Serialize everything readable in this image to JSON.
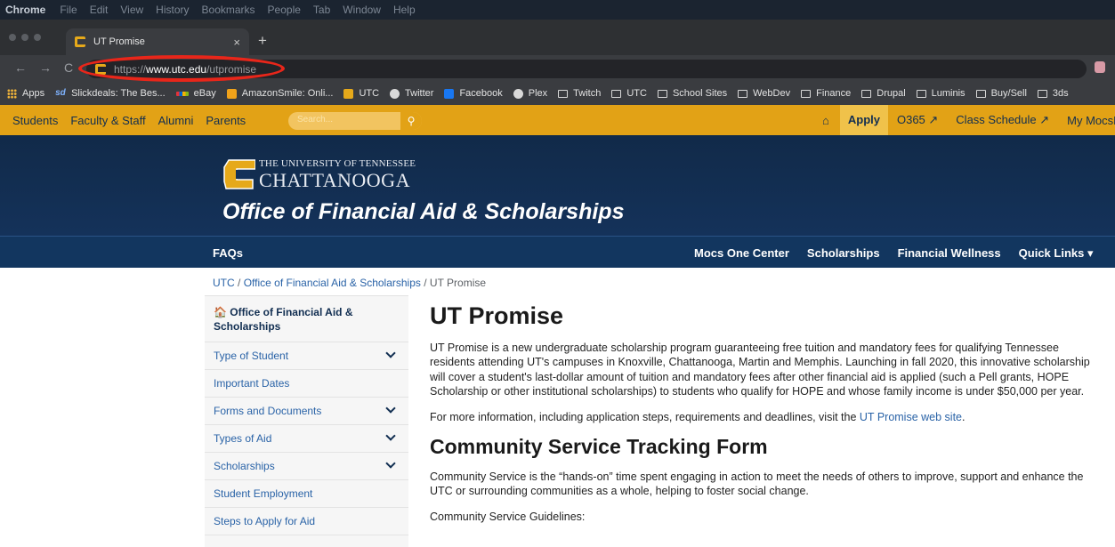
{
  "os_menubar": [
    "Chrome",
    "File",
    "Edit",
    "View",
    "History",
    "Bookmarks",
    "People",
    "Tab",
    "Window",
    "Help"
  ],
  "browser": {
    "tab_title": "UT Promise",
    "tab_close": "×",
    "new_tab": "+",
    "url_prefix": "https://",
    "url_host": "www.utc.edu",
    "url_path": "/utpromise",
    "bookmarks": [
      {
        "label": "Apps",
        "icon": "apps-icon"
      },
      {
        "label": "Slickdeals: The Bes...",
        "icon": "sd-icon"
      },
      {
        "label": "eBay",
        "icon": "ebay-icon"
      },
      {
        "label": "AmazonSmile: Onli...",
        "icon": "amazon-icon"
      },
      {
        "label": "UTC",
        "icon": "utc-icon"
      },
      {
        "label": "Twitter",
        "icon": "twitter-icon"
      },
      {
        "label": "Facebook",
        "icon": "facebook-icon"
      },
      {
        "label": "Plex",
        "icon": "plex-icon"
      },
      {
        "label": "Twitch",
        "icon": "folder-icon"
      },
      {
        "label": "UTC",
        "icon": "folder-icon"
      },
      {
        "label": "School Sites",
        "icon": "folder-icon"
      },
      {
        "label": "WebDev",
        "icon": "folder-icon"
      },
      {
        "label": "Finance",
        "icon": "folder-icon"
      },
      {
        "label": "Drupal",
        "icon": "folder-icon"
      },
      {
        "label": "Luminis",
        "icon": "folder-icon"
      },
      {
        "label": "Buy/Sell",
        "icon": "folder-icon"
      },
      {
        "label": "3ds",
        "icon": "folder-icon"
      }
    ]
  },
  "utility_bar": {
    "left_links": [
      "Students",
      "Faculty & Staff",
      "Alumni",
      "Parents"
    ],
    "search_placeholder": "Search...",
    "apply": "Apply",
    "o365": "O365 ↗",
    "class_schedule": "Class Schedule ↗",
    "my_mocsnet": "My MocsNet"
  },
  "banner": {
    "university_line1": "THE UNIVERSITY OF TENNESSEE",
    "university_line2": "CHATTANOOGA",
    "office_title": "Office of Financial Aid & Scholarships"
  },
  "site_nav": {
    "faqs": "FAQs",
    "right_links": [
      "Mocs One Center",
      "Scholarships",
      "Financial Wellness",
      "Quick Links ▾"
    ]
  },
  "breadcrumb": {
    "utc": "UTC",
    "sep1": " / ",
    "office": "Office of Financial Aid & Scholarships",
    "sep2": " / ",
    "current": "UT Promise"
  },
  "sidebar": {
    "header": "🏠 Office of Financial Aid & Scholarships",
    "items": [
      {
        "label": "Type of Student",
        "expandable": true
      },
      {
        "label": "Important Dates",
        "expandable": false
      },
      {
        "label": "Forms and Documents",
        "expandable": true
      },
      {
        "label": "Types of Aid",
        "expandable": true
      },
      {
        "label": "Scholarships",
        "expandable": true
      },
      {
        "label": "Student Employment",
        "expandable": false
      },
      {
        "label": "Steps to Apply for Aid",
        "expandable": false
      }
    ]
  },
  "main": {
    "title": "UT Promise",
    "para1": "UT Promise is a new undergraduate scholarship program guaranteeing free tuition and mandatory fees for qualifying Tennessee residents attending UT's campuses in Knoxville, Chattanooga, Martin and Memphis. Launching in fall 2020, this innovative scholarship will cover a student's last-dollar amount of tuition and mandatory fees after other financial aid is applied (such a Pell grants, HOPE Scholarship or other institutional scholarships) to students who qualify for HOPE and whose family income is under $50,000 per year.",
    "para2_text": "For more information, including application steps, requirements and deadlines, visit the ",
    "para2_link": "UT Promise web site",
    "para2_end": ".",
    "h2": "Community Service Tracking Form",
    "para3": "Community Service is the “hands-on” time spent engaging in action to meet the needs of others to improve, support and enhance the UTC or surrounding communities as a whole, helping to foster social change.",
    "para4": "Community Service Guidelines:"
  },
  "colors": {
    "utility_gold": "#e2a216",
    "banner_navy": "#112a49",
    "nav_blue": "#12365f",
    "annotation_red": "#e8261a",
    "link_blue": "#2a63a7"
  }
}
